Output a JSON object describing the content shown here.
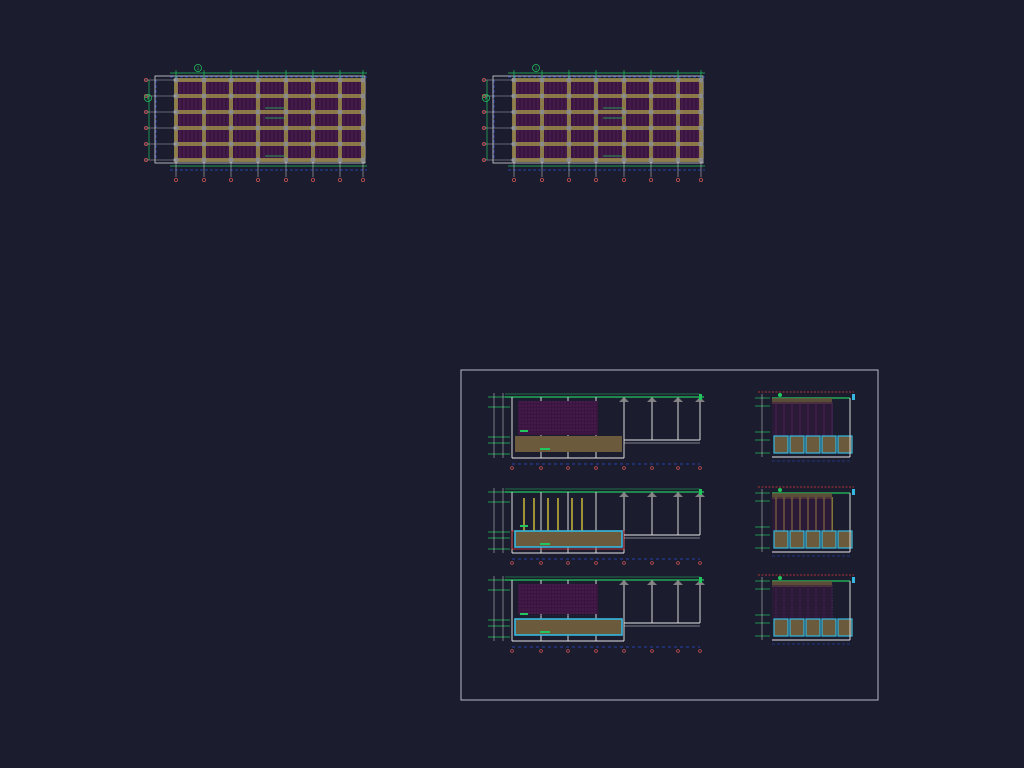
{
  "canvas": {
    "background": "#1b1c2e"
  },
  "colors": {
    "fill": "#3a1540",
    "hatch": "#5a2a66",
    "beam": "#9a8a4a",
    "beamDark": "#6a5a3a",
    "column": "#8a8a8a",
    "axis": "#c85050",
    "dim": "#22c55e",
    "dimDash": "#2a4fd8",
    "outline": "#d8d8d8",
    "yellow": "#e6d23a",
    "cyan": "#35b8e0",
    "slab": "#6b5a3c",
    "red": "#e03c3c",
    "white": "#e6e6e6",
    "frame": "#b8b8c8"
  },
  "plans": [
    {
      "id": "plan-left",
      "markers": [
        "1",
        "A"
      ]
    },
    {
      "id": "plan-right",
      "markers": [
        "1",
        "A"
      ]
    }
  ],
  "sheet": {
    "sections": [
      {
        "id": "section-1",
        "variant": "a"
      },
      {
        "id": "section-2",
        "variant": "b"
      },
      {
        "id": "section-3",
        "variant": "c"
      }
    ],
    "details": [
      {
        "id": "detail-1"
      },
      {
        "id": "detail-2"
      },
      {
        "id": "detail-3"
      }
    ]
  }
}
